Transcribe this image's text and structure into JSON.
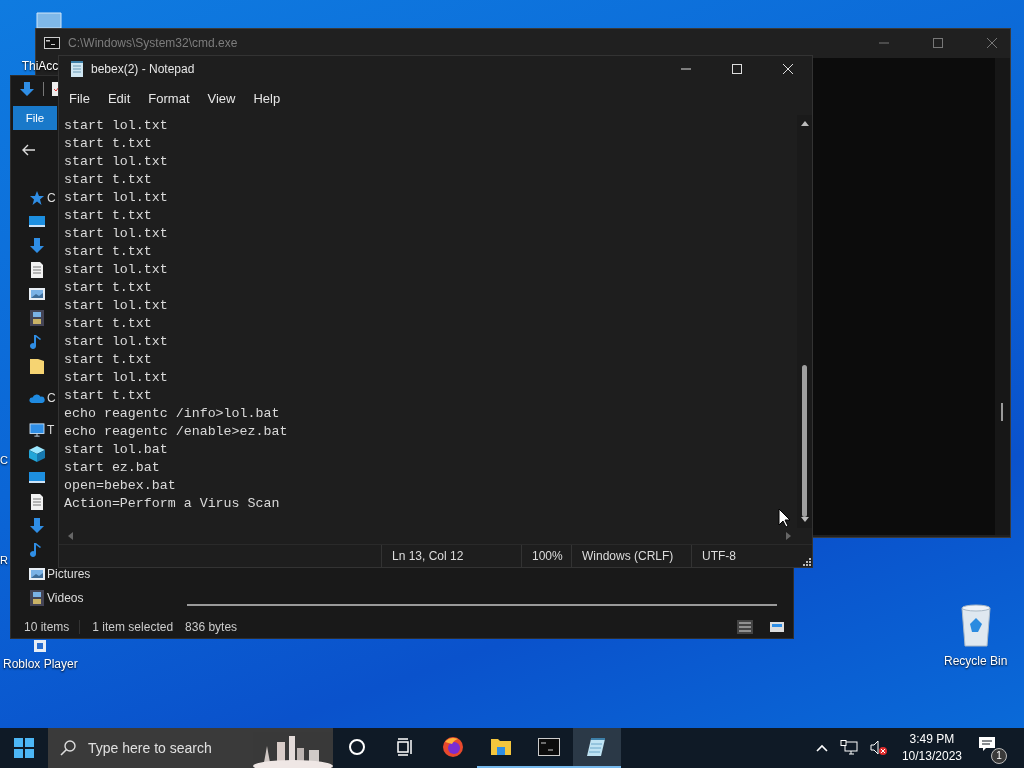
{
  "desktop": {
    "icons": [
      {
        "kind": "folder",
        "label": "ThiAcc"
      },
      {
        "kind": "partial",
        "label": "C"
      },
      {
        "kind": "partial",
        "label": "R"
      },
      {
        "kind": "game",
        "label": "Roblox Player"
      },
      {
        "kind": "recycle",
        "label": "Recycle Bin"
      }
    ]
  },
  "cmd_window": {
    "title": "C:\\Windows\\System32\\cmd.exe"
  },
  "explorer_window": {
    "ribbon_tabs": [
      {
        "label": "File",
        "selected": true
      }
    ],
    "sidebar": {
      "items": [
        {
          "kind": "star",
          "label": "C"
        },
        {
          "kind": "desktop"
        },
        {
          "kind": "download"
        },
        {
          "kind": "document"
        },
        {
          "kind": "picture"
        },
        {
          "kind": "video"
        },
        {
          "kind": "music"
        },
        {
          "kind": "folder"
        },
        {
          "kind": "cloud",
          "label": "C"
        },
        {
          "kind": "pc",
          "label": "T"
        },
        {
          "kind": "cube"
        },
        {
          "kind": "desktop"
        },
        {
          "kind": "document"
        },
        {
          "kind": "download"
        },
        {
          "kind": "music"
        },
        {
          "kind": "picture",
          "label": "Pictures"
        },
        {
          "kind": "video",
          "label": "Videos"
        }
      ]
    },
    "status_bar": [
      "10 items",
      "1 item selected",
      "836 bytes"
    ]
  },
  "notepad": {
    "title": "bebex(2) - Notepad",
    "menu": [
      "File",
      "Edit",
      "Format",
      "View",
      "Help"
    ],
    "lines": [
      "start lol.txt",
      "start t.txt",
      "start lol.txt",
      "start t.txt",
      "start lol.txt",
      "start t.txt",
      "start lol.txt",
      "start t.txt",
      "start lol.txt",
      "start t.txt",
      "start lol.txt",
      "start t.txt",
      "start lol.txt",
      "start t.txt",
      "start lol.txt",
      "start t.txt",
      "echo reagentc /info>lol.bat",
      "echo reagentc /enable>ez.bat",
      "start lol.bat",
      "start ez.bat",
      "open=bebex.bat",
      "Action=Perform a Virus Scan"
    ],
    "status_bar": [
      "Ln 13, Col 12",
      "100%",
      "Windows (CRLF)",
      "UTF-8"
    ]
  },
  "taskbar": {
    "search": {
      "placeholder": "Type here to search"
    },
    "apps": [
      {
        "kind": "cortana",
        "running": false,
        "selected": false
      },
      {
        "kind": "taskview",
        "running": false,
        "selected": false
      },
      {
        "kind": "firefox",
        "running": false,
        "selected": false
      },
      {
        "kind": "explorer",
        "running": true,
        "selected": false
      },
      {
        "kind": "terminal",
        "running": true,
        "selected": false
      },
      {
        "kind": "notepad",
        "running": true,
        "selected": true
      }
    ],
    "time": "3:49 PM",
    "date": "10/13/2023",
    "notification_count": "1"
  }
}
